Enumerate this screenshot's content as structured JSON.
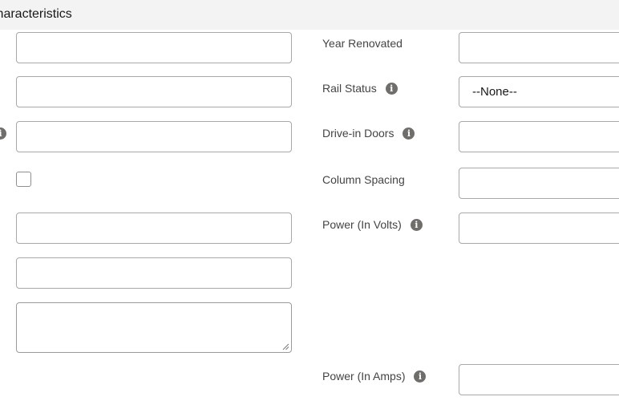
{
  "header": {
    "title": "Characteristics"
  },
  "right_column": {
    "year_renovated_label": "Year Renovated",
    "rail_status_label": "Rail Status",
    "rail_status_value": "--None--",
    "drive_in_doors_label": "Drive-in Doors",
    "column_spacing_label": "Column Spacing",
    "power_volts_label": "Power (In Volts)",
    "power_amps_label": "Power (In Amps)"
  },
  "icons": {
    "info": "info-icon",
    "info_glyph": "i"
  },
  "colors": {
    "header_bg": "#f3f3f3",
    "border": "#a8a8a8",
    "info_icon": "#706e6b"
  }
}
